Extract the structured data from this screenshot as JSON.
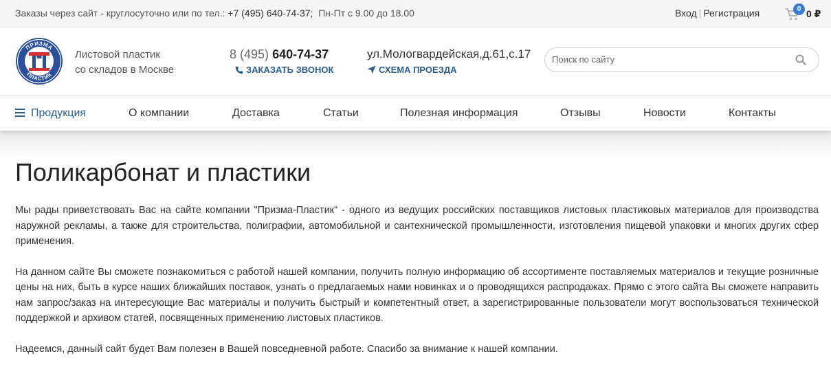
{
  "topbar": {
    "info_prefix": "Заказы через сайт - круглосуточно или по тел.: ",
    "info_phone": "+7 (495) 640-74-37;",
    "info_hours": "Пн-Пт с 9.00 до 18.00",
    "login": "Вход",
    "divider": "|",
    "register": "Регистрация",
    "cart_count": "0",
    "cart_sum": "0 ₽"
  },
  "header": {
    "tagline_line1": "Листовой пластик",
    "tagline_line2": "со складов в Москве",
    "phone_code": "8 (495)",
    "phone_number": "640-74-37",
    "callback_label": "Заказать звонок",
    "address": "ул.Мологвардейская,д.61,с.17",
    "route_label": "Схема проезда",
    "search_placeholder": "Поиск по сайту",
    "logo_text_top": "ПРИЗМА",
    "logo_text_bottom": "ПЛАСТИК"
  },
  "nav": {
    "items": [
      "Продукция",
      "О компании",
      "Доставка",
      "Статьи",
      "Полезная информация",
      "Отзывы",
      "Новости",
      "Контакты"
    ]
  },
  "main": {
    "title": "Поликарбонат и пластики",
    "paragraphs": [
      "Мы рады приветствовать Вас на сайте компании \"Призма-Пластик\" - одного из ведущих российских поставщиков листовых пластиковых материалов для производства наружной рекламы, а также для строительства, полиграфии, автомобильной и сантехнической промышленности, изготовления пищевой упаковки и многих других сфер применения.",
      "На данном сайте Вы сможете познакомиться с работой нашей компании, получить полную информацию об ассортименте поставляемых материалов и текущие розничные цены на них, быть в курсе наших ближайших поставок, узнать о предлагаемых нами новинках и о проводящихся распродажах. Прямо с этого сайта Вы сможете направить нам запрос/заказ на интересующие Вас материалы и получить быстрый и компетентный ответ, а зарегистрированные пользователи могут воспользоваться технической поддержкой и архивом статей, посвященных применению листовых пластиков.",
      "Надеемся, данный сайт будет Вам полезен в Вашей повседневной работе. Спасибо за внимание к нашей компании."
    ]
  },
  "colors": {
    "accent": "#2b5d8f",
    "badge": "#3a7bd5",
    "logo_blue": "#2a4f9c",
    "logo_red": "#d32f2f"
  },
  "icons": [
    "cart-icon",
    "phone-icon",
    "location-arrow-icon",
    "search-icon",
    "menu-icon"
  ]
}
